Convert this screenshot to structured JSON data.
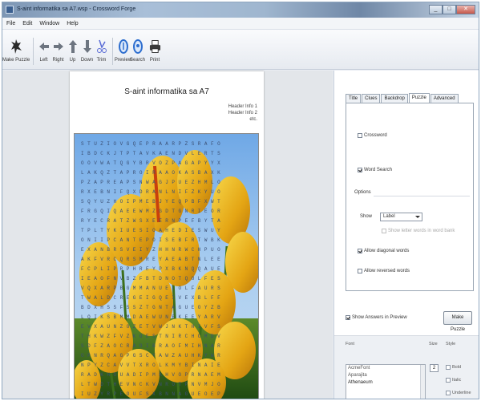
{
  "window": {
    "title": "S-aint informatika sa A7.wsp - Crossword Forge"
  },
  "menu": [
    "File",
    "Edit",
    "Window",
    "Help"
  ],
  "toolbar": [
    {
      "label": "Make Puzzle",
      "icon": "make-puzzle-icon"
    },
    {
      "label": "Left",
      "icon": "arrow-left-icon"
    },
    {
      "label": "Right",
      "icon": "arrow-right-icon"
    },
    {
      "label": "Up",
      "icon": "arrow-up-icon"
    },
    {
      "label": "Down",
      "icon": "arrow-down-icon"
    },
    {
      "label": "Trim",
      "icon": "trim-icon"
    },
    {
      "label": "Preview",
      "icon": "preview-icon"
    },
    {
      "label": "Search",
      "icon": "search-icon"
    },
    {
      "label": "Print",
      "icon": "print-icon"
    }
  ],
  "document": {
    "title": "S-aint informatika sa A7",
    "header_lines": [
      "Header Info 1",
      "Header Info 2",
      "etc."
    ],
    "grid_rows": [
      "S T U Z I O V G Q E P R A A R P Z S R A F O",
      "I B D C K J T P T A V K A E N D V L E R T S",
      "O O V W A T Q G Y B R V O Z P A G A P Y Y X",
      "L A K Q Z T A P R O I R A A O K A S B A X K",
      "P Z A P R E A P S N W A G J P U E Z H M L O",
      "R X E B N I F Q X D R A N L N I F Z K Y U O",
      "S Q Y U Z H O I P M E B J Y E Q P B F X W T",
      "F R G Q I Q A E E W M Z G D T G N R I E O R",
      "R Y E C R A T Z W S X E E R N P E F B Y T A",
      "T P L T Y K I U E S I O A H E D I E S W U Y",
      "O N I I P C A N T E P O I S E B F R T W B K",
      "E X A N B R S V E I Y Z H H N R W C H P U O",
      "A K F V R C Q R S M R E Y A E A B T N L E E",
      "F C P L I P R P H R E Y P X B K N Q Q A U E",
      "I E A O F N V B Z F B T D N O T Q O L F E S",
      "V Q X A R P B G M M A N U E L O L F A U R S",
      "T W A L D C R E G E I G Q E I V E X B L F F",
      "B D X H S S F S S Z T G N T A G U E O Y Z B",
      "L Q I K S B M M D A E W U N E K E E Y A R V",
      "E V X A U N Z O Z E T V W J N K T H I V F S",
      "T H K W Z F V Z K O E S T N I R C H C M D V",
      "S D F Z A O C R A O I B R A O F M I H N A R",
      "O P N R Q A G P G S C Y A W Z A U H K Y W R",
      "N P Y Z C A V V T X R O L K M Y B I N A I E",
      "R A D K H O U A D I P M K H V O P R N A E M",
      "L T W D T H E V N C K V N R O T P N V M J O",
      "I U Z Y R P E O U F S X B N N A G U E O E P"
    ]
  },
  "tabs": [
    "Title",
    "Clues",
    "Backdrop",
    "Puzzle",
    "Advanced"
  ],
  "active_tab": "Puzzle",
  "puzzle_panel": {
    "crossword_label": "Crossword",
    "crossword_checked": false,
    "wordsearch_label": "Word Search",
    "wordsearch_checked": true,
    "options_label": "Options",
    "show_label": "Show",
    "show_value": "Label",
    "uppercase_label": "Show letter words in word bank",
    "uppercase_checked": false,
    "diagonal_label": "Allow diagonal words",
    "diagonal_checked": true,
    "reversed_label": "Allow reversed words",
    "reversed_checked": false
  },
  "answers_preview": {
    "label": "Show Answers in Preview",
    "checked": true
  },
  "make_button": "Make Puzzle",
  "font_section": {
    "font_header": "Font",
    "size_header": "Size",
    "style_header": "Style",
    "fonts": [
      "AcmeFont",
      "Aparajita",
      "Athenaeum"
    ],
    "selected_font": "Athenaeum",
    "size_value": "2",
    "styles": [
      "Bold",
      "Italic",
      "Underline"
    ]
  }
}
